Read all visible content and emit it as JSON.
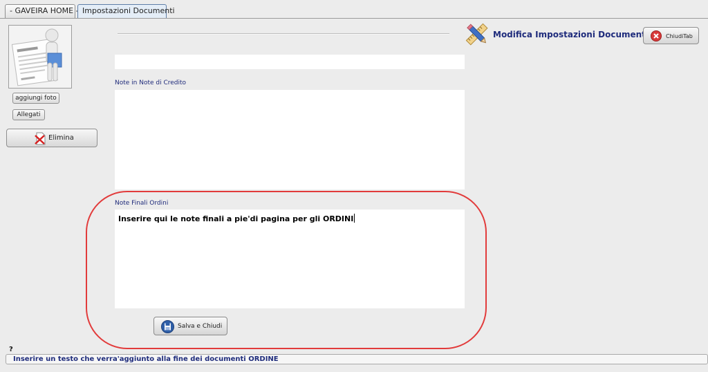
{
  "tabs": [
    {
      "label": "- GAVEIRA HOME -"
    },
    {
      "label": "Impostazioni Documenti"
    }
  ],
  "left_panel": {
    "photo_icon": "contract-icon",
    "add_photo_label": "aggiungi foto",
    "attachments_label": "Allegati",
    "delete_label": "Elimina"
  },
  "header": {
    "title": "Modifica Impostazioni Documenti",
    "close_tab_label": "ChiudiTab"
  },
  "form": {
    "field_top_value": "",
    "credit_notes_label": "Note in Note di Credito",
    "credit_notes_value": "",
    "order_notes_label": "Note Finali Ordini",
    "order_notes_value": "Inserire qui le note finali a pie'di pagina per gli ORDINI",
    "save_label": "Salva e Chiudi"
  },
  "status": {
    "help_mark": "?",
    "text": "Inserire un testo che verra'aggiunto alla fine dei documenti ORDINE"
  },
  "colors": {
    "accent_text": "#1f2c7c",
    "highlight": "#e23b3b"
  }
}
